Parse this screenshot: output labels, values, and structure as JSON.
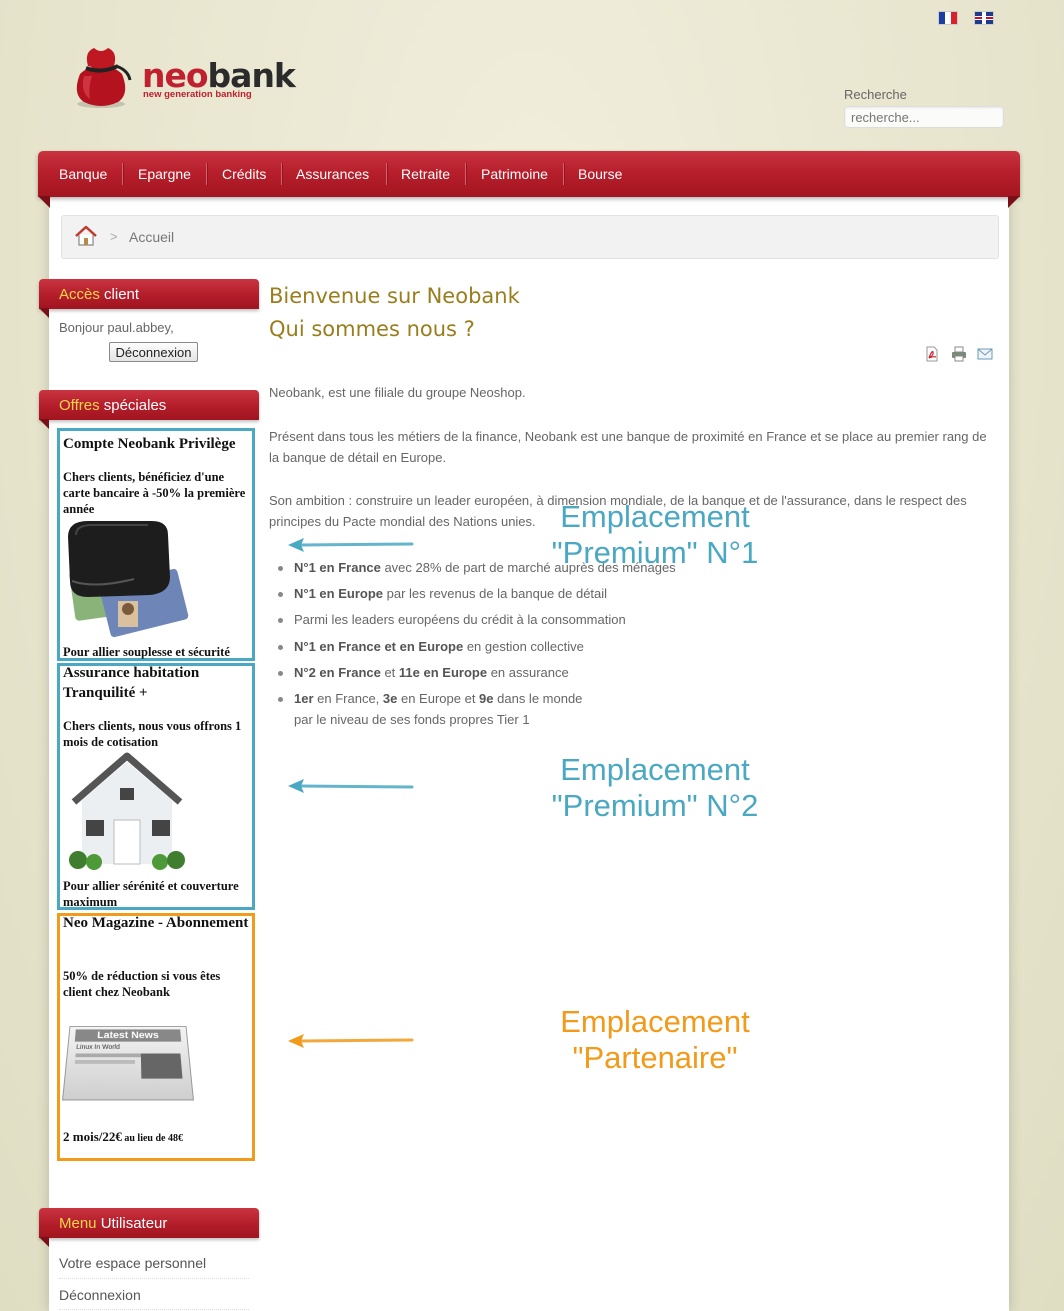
{
  "header": {
    "brand_neo": "neo",
    "brand_bank": "bank",
    "tagline": "new generation banking",
    "languages": [
      "fr",
      "en"
    ],
    "search_label": "Recherche",
    "search_placeholder": "recherche..."
  },
  "nav": {
    "items": [
      "Banque",
      "Epargne",
      "Crédits",
      "Assurances",
      "Retraite",
      "Patrimoine",
      "Bourse"
    ]
  },
  "breadcrumb": {
    "current": "Accueil",
    "separator": ">"
  },
  "client_access": {
    "title_hl": "Accès",
    "title_rest": " client",
    "greeting": "Bonjour paul.abbey,",
    "logout_label": "Déconnexion"
  },
  "offers": {
    "title_hl": "Offres",
    "title_rest": " spéciales",
    "items": [
      {
        "title": "Compte Neobank Privilège",
        "desc": "Chers clients, bénéficiez d'une carte bancaire à -50% la première année",
        "footer": "Pour allier souplesse et sécurité"
      },
      {
        "title": "Assurance habitation Tranquilité +",
        "desc": "Chers clients, nous vous offrons 1 mois de cotisation",
        "footer": "Pour allier sérénité et couverture maximum"
      },
      {
        "title": "Neo Magazine - Abonnement",
        "desc": "50% de réduction si vous êtes client chez Neobank",
        "price_big": "2 mois/22€",
        "price_small": " au lieu de 48€",
        "news_label": "Latest News",
        "news_sub": "Linux In World"
      }
    ]
  },
  "user_menu": {
    "title_hl": "Menu",
    "title_rest": " Utilisateur",
    "links": [
      "Votre espace personnel",
      "Déconnexion"
    ]
  },
  "article": {
    "title_line1": "Bienvenue sur Neobank",
    "title_line2": "Qui sommes nous ?",
    "para1": "Neobank, est une filiale du groupe Neoshop.",
    "para2": "Présent dans tous les métiers de la finance, Neobank est une banque de proximité en France et se place au premier rang de la banque de détail en Europe.",
    "para3": "Son ambition : construire un leader européen, à dimension mondiale, de la banque et de l'assurance, dans le respect des principes du Pacte mondial des Nations unies.",
    "list": [
      {
        "b1": "N°1 en France",
        "t1": " avec 28% de part de marché auprès des ménages"
      },
      {
        "b1": "N°1 en Europe",
        "t1": " par les revenus de la banque de détail"
      },
      {
        "t0": "Parmi les leaders européens du crédit à la consommation"
      },
      {
        "b1": "N°1 en France et en Europe",
        "t1": " en gestion collective"
      },
      {
        "b1": "N°2 en France",
        "t1": " et ",
        "b2": "11e en Europe",
        "t2": " en assurance"
      },
      {
        "b1": "1er",
        "t1": " en France, ",
        "b2": "3e",
        "t2": " en Europe et ",
        "b3": "9e",
        "t3": " dans le monde",
        "line2": "par le niveau de ses fonds propres Tier 1"
      }
    ],
    "icons": [
      "pdf-icon",
      "print-icon",
      "email-icon"
    ]
  },
  "annotations": {
    "premium1_l1": "Emplacement",
    "premium1_l2": "\"Premium\" N°1",
    "premium2_l1": "Emplacement",
    "premium2_l2": "\"Premium\" N°2",
    "partner_l1": "Emplacement",
    "partner_l2": "\"Partenaire\"",
    "colors": {
      "premium": "#4aa8c2",
      "partner": "#f29a1a"
    }
  }
}
